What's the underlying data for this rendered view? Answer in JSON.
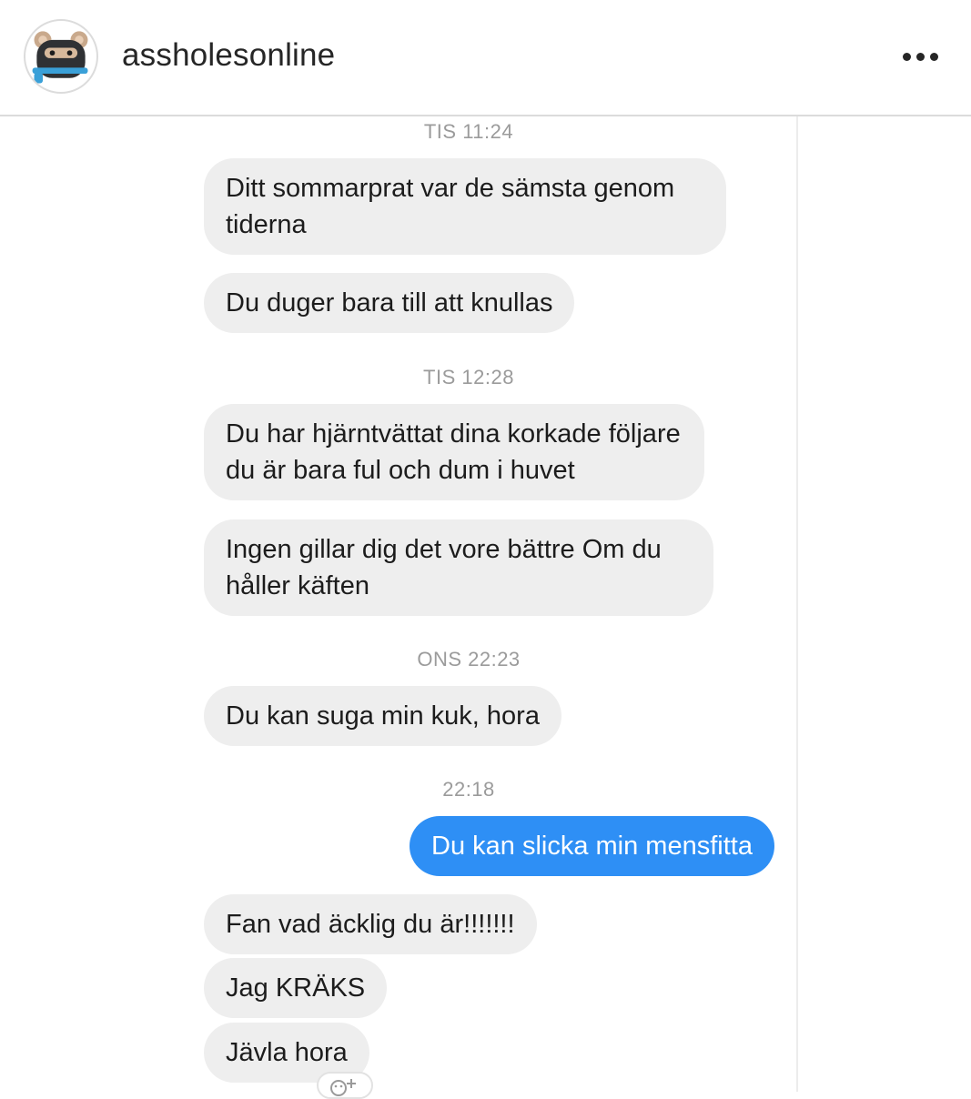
{
  "header": {
    "username": "assholesonline",
    "avatar_icon": "ninja-bear-icon",
    "more_icon": "more-options-icon"
  },
  "chat": {
    "timestamps": [
      "TIS 11:24",
      "TIS 12:28",
      "ONS 22:23",
      "22:18"
    ],
    "messages": [
      {
        "direction": "in",
        "text": "Ditt sommarprat var de sämsta genom tiderna"
      },
      {
        "direction": "in",
        "text": "Du duger bara till att knullas"
      },
      {
        "direction": "in",
        "text": "Du har hjärntvättat dina korkade följare du är bara ful och dum i huvet"
      },
      {
        "direction": "in",
        "text": "Ingen gillar dig det vore bättre Om du håller käften"
      },
      {
        "direction": "in",
        "text": "Du kan suga min kuk, hora"
      },
      {
        "direction": "out",
        "text": "Du kan slicka min mensfitta"
      },
      {
        "direction": "in",
        "text": "Fan vad äcklig du är!!!!!!!"
      },
      {
        "direction": "in",
        "text": "Jag KRÄKS"
      },
      {
        "direction": "in",
        "text": "Jävla hora"
      }
    ],
    "reaction_icon": "add-reaction-icon"
  },
  "colors": {
    "incoming_bubble": "#eeeeee",
    "outgoing_bubble": "#2e8ff5",
    "timestamp": "#9b9b9b"
  }
}
